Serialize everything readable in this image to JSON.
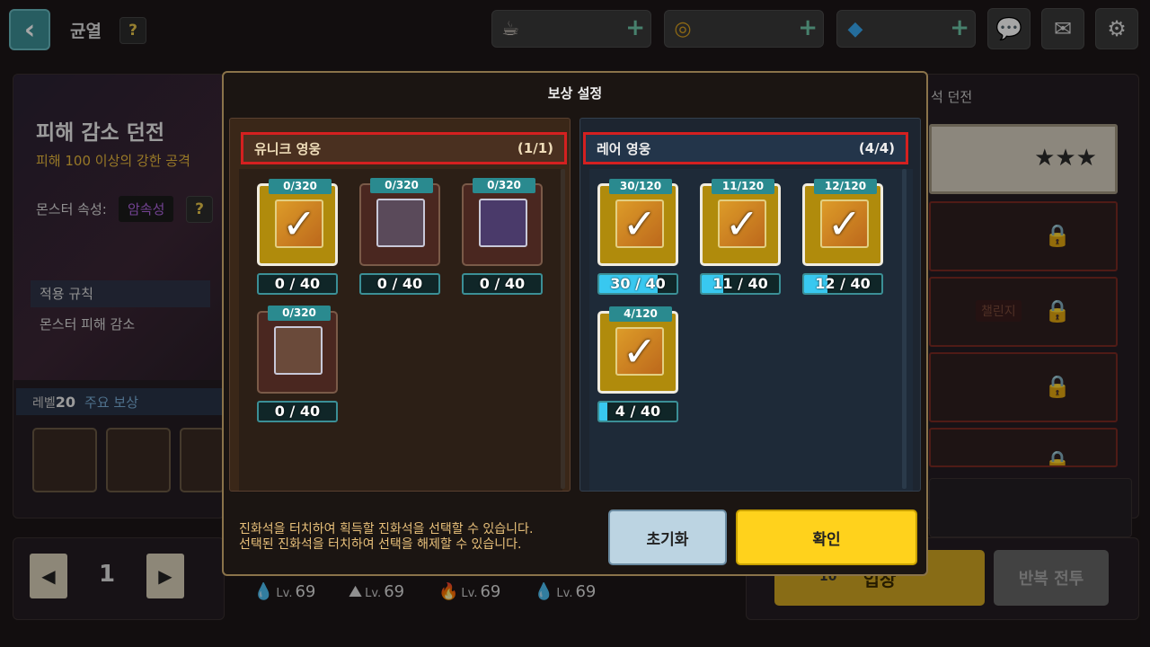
{
  "topbar": {
    "title": "균열",
    "help": "?",
    "resources": [
      {
        "icon": "coffee-icon"
      },
      {
        "icon": "gold-coin-icon"
      },
      {
        "icon": "gem-icon"
      }
    ],
    "plus": "+"
  },
  "dungeon": {
    "title": "피해 감소 던전",
    "subtitle": "피해 100 이상의 강한 공격",
    "attr_label": "몬스터 속성:",
    "attr_value": "암속성",
    "rule_head": "적용 규칙",
    "rule_body": "몬스터 피해 감소",
    "level_label": "레벨",
    "level_value": "20",
    "reward_label": "주요 보상"
  },
  "pager": {
    "prev": "◀",
    "page": "1",
    "next": "▶"
  },
  "right_panel": {
    "title_partial": "석 던전",
    "stars": "★★★",
    "challenge": "챌린지",
    "enter": "입장",
    "enter_cost": "10",
    "repeat": "반복 전투"
  },
  "party": [
    {
      "lv": "Lv.",
      "value": "69"
    },
    {
      "lv": "Lv.",
      "value": "69"
    },
    {
      "lv": "Lv.",
      "value": "69"
    },
    {
      "lv": "Lv.",
      "value": "69"
    }
  ],
  "modal": {
    "title": "보상 설정",
    "unique": {
      "label": "유니크 영웅",
      "count": "(1/1)",
      "cards": [
        {
          "tag": "0/320",
          "selected": true,
          "progress": "0 / 40",
          "fill": 0
        },
        {
          "tag": "0/320",
          "selected": false,
          "progress": "0 / 40",
          "fill": 0
        },
        {
          "tag": "0/320",
          "selected": false,
          "progress": "0 / 40",
          "fill": 0
        },
        {
          "tag": "0/320",
          "selected": false,
          "progress": "0 / 40",
          "fill": 0
        }
      ]
    },
    "rare": {
      "label": "레어 영웅",
      "count": "(4/4)",
      "cards": [
        {
          "tag": "30/120",
          "selected": true,
          "progress": "30 / 40",
          "fill": 0.75
        },
        {
          "tag": "11/120",
          "selected": true,
          "progress": "11 / 40",
          "fill": 0.275
        },
        {
          "tag": "12/120",
          "selected": true,
          "progress": "12 / 40",
          "fill": 0.3
        },
        {
          "tag": "4/120",
          "selected": true,
          "progress": "4 / 40",
          "fill": 0.1
        }
      ]
    },
    "help_line1": "진화석을 터치하여 획득할 진화석을 선택할 수 있습니다.",
    "help_line2": "선택된 진화석을 터치하여 선택을 해제할 수 있습니다.",
    "reset": "초기화",
    "confirm": "확인",
    "check": "✓"
  },
  "colors": {
    "accent": "#ffd21c",
    "highlight_border": "#d42020",
    "teal": "#2a8a8f",
    "progress_fill": "#38c8f0"
  }
}
